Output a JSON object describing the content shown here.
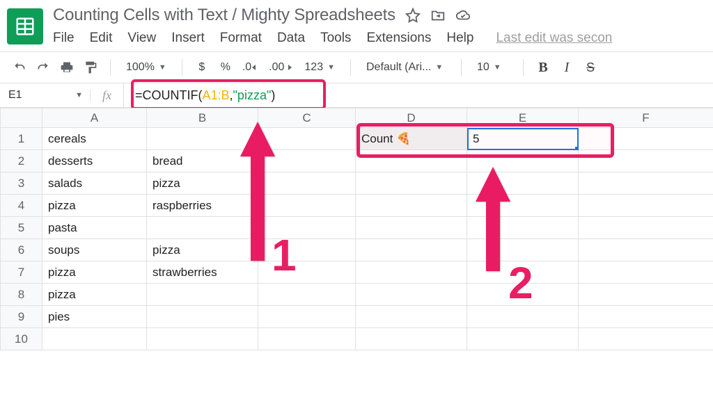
{
  "header": {
    "doc_title": "Counting Cells with Text / Mighty Spreadsheets",
    "last_edit": "Last edit was secon"
  },
  "menu": {
    "file": "File",
    "edit": "Edit",
    "view": "View",
    "insert": "Insert",
    "format": "Format",
    "data": "Data",
    "tools": "Tools",
    "extensions": "Extensions",
    "help": "Help"
  },
  "toolbar": {
    "zoom": "100%",
    "currency": "$",
    "percent": "%",
    "dec_dec": ".0",
    "inc_dec": ".00",
    "more_formats": "123",
    "font": "Default (Ari...",
    "font_size": "10",
    "bold": "B",
    "italic": "I",
    "strike": "S"
  },
  "formula_bar": {
    "name_box": "E1",
    "fx": "fx",
    "formula_prefix": "=COUNTIF(",
    "formula_range": "A1:B",
    "formula_mid": ",",
    "formula_str": "\"pizza\"",
    "formula_suffix": ")"
  },
  "columns": [
    "A",
    "B",
    "C",
    "D",
    "E",
    "F"
  ],
  "rows": [
    {
      "n": "1",
      "A": "cereals",
      "B": "",
      "D": "Count 🍕",
      "E": "5"
    },
    {
      "n": "2",
      "A": "desserts",
      "B": "bread"
    },
    {
      "n": "3",
      "A": "salads",
      "B": "pizza"
    },
    {
      "n": "4",
      "A": "pizza",
      "B": "raspberries"
    },
    {
      "n": "5",
      "A": "pasta",
      "B": ""
    },
    {
      "n": "6",
      "A": "soups",
      "B": "pizza"
    },
    {
      "n": "7",
      "A": "pizza",
      "B": "strawberries"
    },
    {
      "n": "8",
      "A": "pizza",
      "B": ""
    },
    {
      "n": "9",
      "A": "pies",
      "B": ""
    },
    {
      "n": "10",
      "A": "",
      "B": ""
    }
  ],
  "annotations": {
    "label1": "1",
    "label2": "2"
  }
}
